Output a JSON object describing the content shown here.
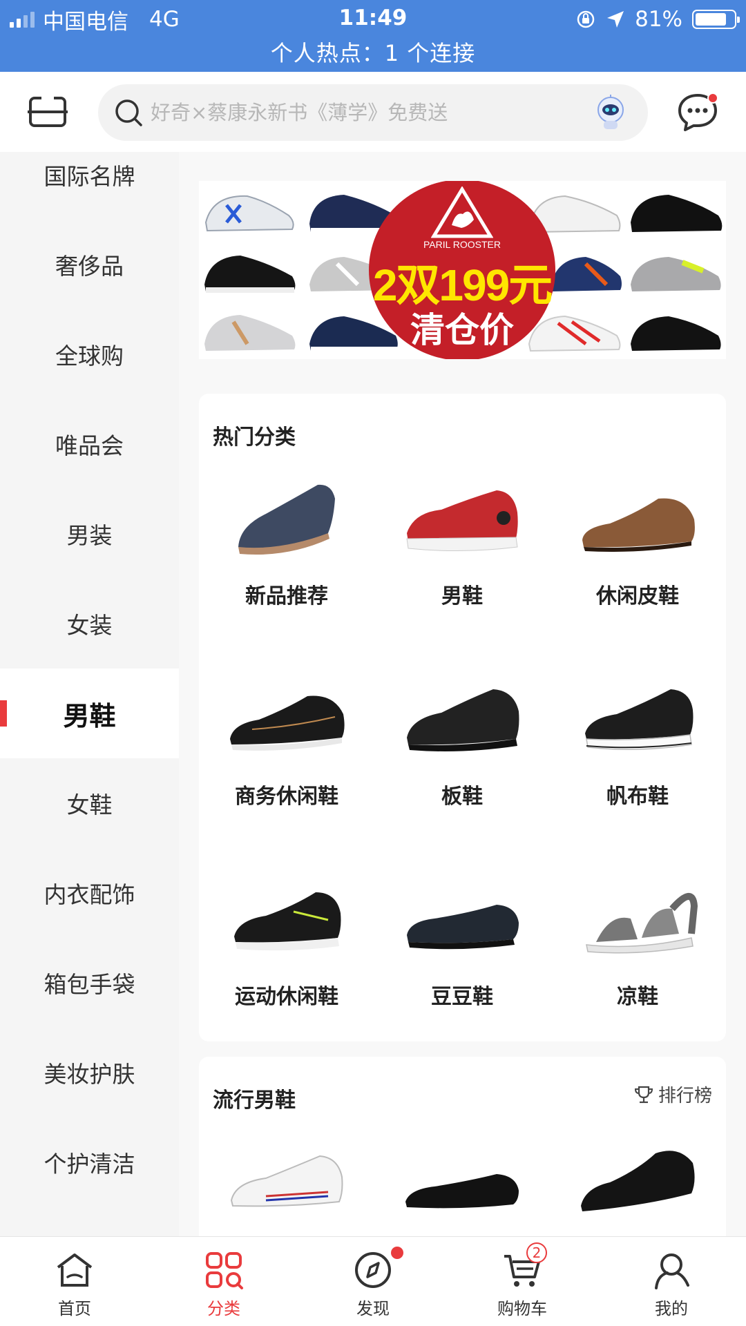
{
  "status_bar": {
    "carrier": "中国电信",
    "network": "4G",
    "time": "11:49",
    "battery": "81%",
    "battery_level": 0.81,
    "hotspot": "个人热点：1 个连接"
  },
  "search": {
    "placeholder": "好奇×蔡康永新书《薄学》免费送"
  },
  "sidebar": {
    "items": [
      {
        "label": "国际名牌"
      },
      {
        "label": "奢侈品"
      },
      {
        "label": "全球购"
      },
      {
        "label": "唯品会"
      },
      {
        "label": "男装"
      },
      {
        "label": "女装"
      },
      {
        "label": "男鞋"
      },
      {
        "label": "女鞋"
      },
      {
        "label": "内衣配饰"
      },
      {
        "label": "箱包手袋"
      },
      {
        "label": "美妆护肤"
      },
      {
        "label": "个护清洁"
      }
    ],
    "active_index": 6
  },
  "banner": {
    "brand": "PARIL ROOSTER",
    "price": "2双199元",
    "subtitle": "清仓价"
  },
  "hot_categories": {
    "title": "热门分类",
    "items": [
      {
        "label": "新品推荐"
      },
      {
        "label": "男鞋"
      },
      {
        "label": "休闲皮鞋"
      },
      {
        "label": "商务休闲鞋"
      },
      {
        "label": "板鞋"
      },
      {
        "label": "帆布鞋"
      },
      {
        "label": "运动休闲鞋"
      },
      {
        "label": "豆豆鞋"
      },
      {
        "label": "凉鞋"
      }
    ]
  },
  "popular": {
    "title": "流行男鞋",
    "rank_label": "排行榜"
  },
  "tabbar": {
    "tabs": [
      {
        "label": "首页"
      },
      {
        "label": "分类"
      },
      {
        "label": "发现"
      },
      {
        "label": "购物车"
      },
      {
        "label": "我的"
      }
    ],
    "cart_badge": "2",
    "active_tab": "分类"
  },
  "colors": {
    "status_bar": "#4a86dd",
    "accent": "#e93b3d",
    "banner_red": "#c41f28",
    "banner_price": "#ffe600"
  }
}
